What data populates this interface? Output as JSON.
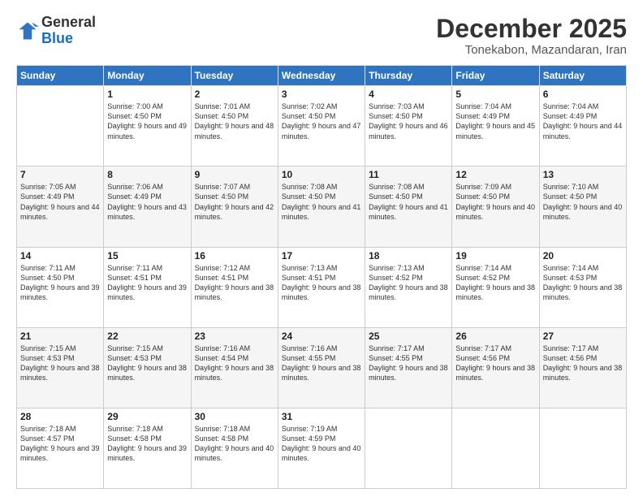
{
  "header": {
    "logo_line1": "General",
    "logo_line2": "Blue",
    "month": "December 2025",
    "location": "Tonekabon, Mazandaran, Iran"
  },
  "weekdays": [
    "Sunday",
    "Monday",
    "Tuesday",
    "Wednesday",
    "Thursday",
    "Friday",
    "Saturday"
  ],
  "weeks": [
    [
      {
        "day": "",
        "sunrise": "",
        "sunset": "",
        "daylight": ""
      },
      {
        "day": "1",
        "sunrise": "Sunrise: 7:00 AM",
        "sunset": "Sunset: 4:50 PM",
        "daylight": "Daylight: 9 hours and 49 minutes."
      },
      {
        "day": "2",
        "sunrise": "Sunrise: 7:01 AM",
        "sunset": "Sunset: 4:50 PM",
        "daylight": "Daylight: 9 hours and 48 minutes."
      },
      {
        "day": "3",
        "sunrise": "Sunrise: 7:02 AM",
        "sunset": "Sunset: 4:50 PM",
        "daylight": "Daylight: 9 hours and 47 minutes."
      },
      {
        "day": "4",
        "sunrise": "Sunrise: 7:03 AM",
        "sunset": "Sunset: 4:50 PM",
        "daylight": "Daylight: 9 hours and 46 minutes."
      },
      {
        "day": "5",
        "sunrise": "Sunrise: 7:04 AM",
        "sunset": "Sunset: 4:49 PM",
        "daylight": "Daylight: 9 hours and 45 minutes."
      },
      {
        "day": "6",
        "sunrise": "Sunrise: 7:04 AM",
        "sunset": "Sunset: 4:49 PM",
        "daylight": "Daylight: 9 hours and 44 minutes."
      }
    ],
    [
      {
        "day": "7",
        "sunrise": "Sunrise: 7:05 AM",
        "sunset": "Sunset: 4:49 PM",
        "daylight": "Daylight: 9 hours and 44 minutes."
      },
      {
        "day": "8",
        "sunrise": "Sunrise: 7:06 AM",
        "sunset": "Sunset: 4:49 PM",
        "daylight": "Daylight: 9 hours and 43 minutes."
      },
      {
        "day": "9",
        "sunrise": "Sunrise: 7:07 AM",
        "sunset": "Sunset: 4:50 PM",
        "daylight": "Daylight: 9 hours and 42 minutes."
      },
      {
        "day": "10",
        "sunrise": "Sunrise: 7:08 AM",
        "sunset": "Sunset: 4:50 PM",
        "daylight": "Daylight: 9 hours and 41 minutes."
      },
      {
        "day": "11",
        "sunrise": "Sunrise: 7:08 AM",
        "sunset": "Sunset: 4:50 PM",
        "daylight": "Daylight: 9 hours and 41 minutes."
      },
      {
        "day": "12",
        "sunrise": "Sunrise: 7:09 AM",
        "sunset": "Sunset: 4:50 PM",
        "daylight": "Daylight: 9 hours and 40 minutes."
      },
      {
        "day": "13",
        "sunrise": "Sunrise: 7:10 AM",
        "sunset": "Sunset: 4:50 PM",
        "daylight": "Daylight: 9 hours and 40 minutes."
      }
    ],
    [
      {
        "day": "14",
        "sunrise": "Sunrise: 7:11 AM",
        "sunset": "Sunset: 4:50 PM",
        "daylight": "Daylight: 9 hours and 39 minutes."
      },
      {
        "day": "15",
        "sunrise": "Sunrise: 7:11 AM",
        "sunset": "Sunset: 4:51 PM",
        "daylight": "Daylight: 9 hours and 39 minutes."
      },
      {
        "day": "16",
        "sunrise": "Sunrise: 7:12 AM",
        "sunset": "Sunset: 4:51 PM",
        "daylight": "Daylight: 9 hours and 38 minutes."
      },
      {
        "day": "17",
        "sunrise": "Sunrise: 7:13 AM",
        "sunset": "Sunset: 4:51 PM",
        "daylight": "Daylight: 9 hours and 38 minutes."
      },
      {
        "day": "18",
        "sunrise": "Sunrise: 7:13 AM",
        "sunset": "Sunset: 4:52 PM",
        "daylight": "Daylight: 9 hours and 38 minutes."
      },
      {
        "day": "19",
        "sunrise": "Sunrise: 7:14 AM",
        "sunset": "Sunset: 4:52 PM",
        "daylight": "Daylight: 9 hours and 38 minutes."
      },
      {
        "day": "20",
        "sunrise": "Sunrise: 7:14 AM",
        "sunset": "Sunset: 4:53 PM",
        "daylight": "Daylight: 9 hours and 38 minutes."
      }
    ],
    [
      {
        "day": "21",
        "sunrise": "Sunrise: 7:15 AM",
        "sunset": "Sunset: 4:53 PM",
        "daylight": "Daylight: 9 hours and 38 minutes."
      },
      {
        "day": "22",
        "sunrise": "Sunrise: 7:15 AM",
        "sunset": "Sunset: 4:53 PM",
        "daylight": "Daylight: 9 hours and 38 minutes."
      },
      {
        "day": "23",
        "sunrise": "Sunrise: 7:16 AM",
        "sunset": "Sunset: 4:54 PM",
        "daylight": "Daylight: 9 hours and 38 minutes."
      },
      {
        "day": "24",
        "sunrise": "Sunrise: 7:16 AM",
        "sunset": "Sunset: 4:55 PM",
        "daylight": "Daylight: 9 hours and 38 minutes."
      },
      {
        "day": "25",
        "sunrise": "Sunrise: 7:17 AM",
        "sunset": "Sunset: 4:55 PM",
        "daylight": "Daylight: 9 hours and 38 minutes."
      },
      {
        "day": "26",
        "sunrise": "Sunrise: 7:17 AM",
        "sunset": "Sunset: 4:56 PM",
        "daylight": "Daylight: 9 hours and 38 minutes."
      },
      {
        "day": "27",
        "sunrise": "Sunrise: 7:17 AM",
        "sunset": "Sunset: 4:56 PM",
        "daylight": "Daylight: 9 hours and 38 minutes."
      }
    ],
    [
      {
        "day": "28",
        "sunrise": "Sunrise: 7:18 AM",
        "sunset": "Sunset: 4:57 PM",
        "daylight": "Daylight: 9 hours and 39 minutes."
      },
      {
        "day": "29",
        "sunrise": "Sunrise: 7:18 AM",
        "sunset": "Sunset: 4:58 PM",
        "daylight": "Daylight: 9 hours and 39 minutes."
      },
      {
        "day": "30",
        "sunrise": "Sunrise: 7:18 AM",
        "sunset": "Sunset: 4:58 PM",
        "daylight": "Daylight: 9 hours and 40 minutes."
      },
      {
        "day": "31",
        "sunrise": "Sunrise: 7:19 AM",
        "sunset": "Sunset: 4:59 PM",
        "daylight": "Daylight: 9 hours and 40 minutes."
      },
      {
        "day": "",
        "sunrise": "",
        "sunset": "",
        "daylight": ""
      },
      {
        "day": "",
        "sunrise": "",
        "sunset": "",
        "daylight": ""
      },
      {
        "day": "",
        "sunrise": "",
        "sunset": "",
        "daylight": ""
      }
    ]
  ]
}
